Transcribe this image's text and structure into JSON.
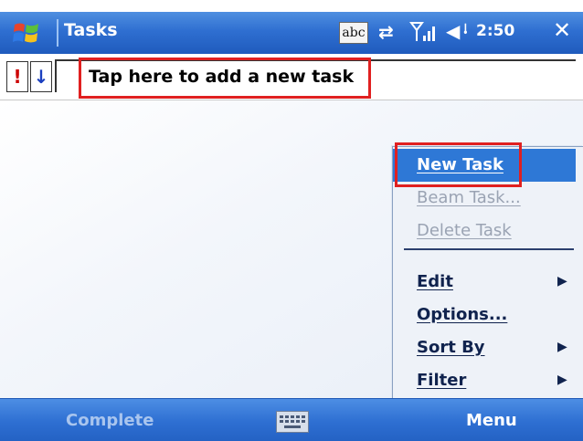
{
  "title_bar": {
    "app_title": "Tasks",
    "input_mode_label": "abc",
    "clock": "2:50",
    "icons": [
      "windows-start-icon",
      "sync-icon",
      "signal-icon",
      "volume-icon",
      "close-icon"
    ]
  },
  "task_entry": {
    "placeholder": "Tap here to add a new task",
    "priority_high_symbol": "!",
    "priority_low_symbol": "↓"
  },
  "menu": {
    "items": [
      {
        "label": "New Task",
        "state": "selected"
      },
      {
        "label": "Beam Task...",
        "state": "disabled"
      },
      {
        "label": "Delete Task",
        "state": "disabled"
      },
      {
        "label": "Edit",
        "state": "enabled",
        "submenu": true
      },
      {
        "label": "Options...",
        "state": "enabled"
      },
      {
        "label": "Sort By",
        "state": "enabled",
        "submenu": true
      },
      {
        "label": "Filter",
        "state": "enabled",
        "submenu": true
      }
    ],
    "submenu_arrow": "▶"
  },
  "soft_keys": {
    "left": "Complete",
    "right": "Menu"
  },
  "colors": {
    "bar_blue": "#2f6fd1",
    "highlight_red": "#e02020",
    "menu_selected": "#2e78d6"
  }
}
